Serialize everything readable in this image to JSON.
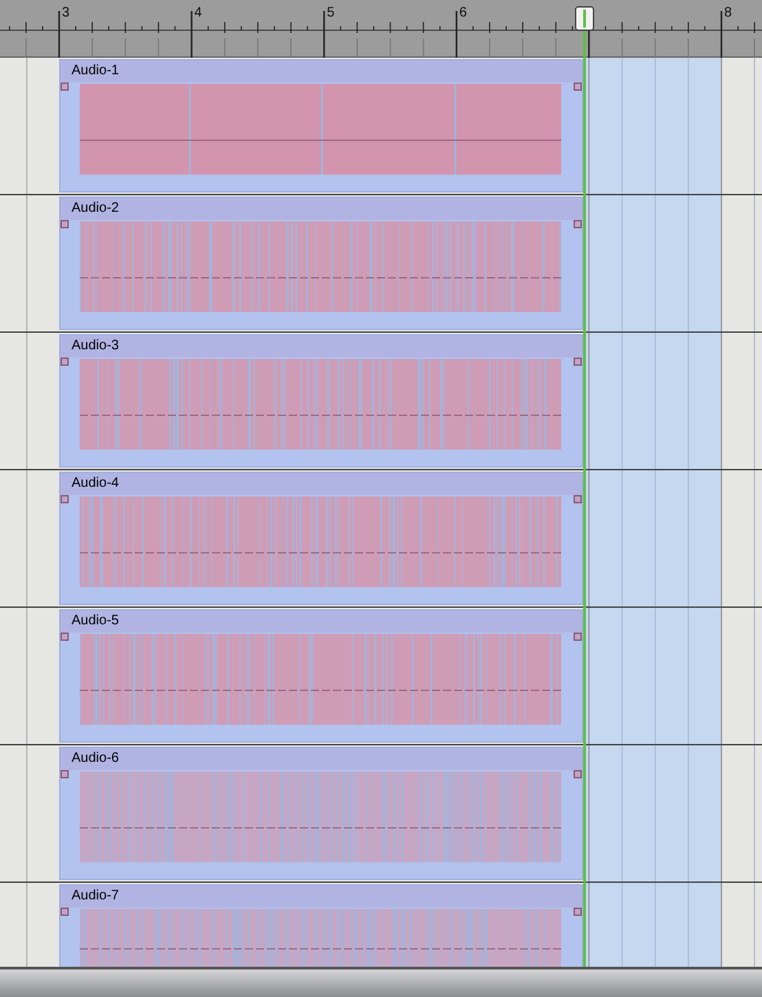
{
  "ruler": {
    "labels": [
      "3",
      "4",
      "5",
      "6",
      "8"
    ]
  },
  "tracks": [
    {
      "name": "Audio-1",
      "kind": "sparse"
    },
    {
      "name": "Audio-2",
      "kind": "medium"
    },
    {
      "name": "Audio-3",
      "kind": "medium"
    },
    {
      "name": "Audio-4",
      "kind": "medium"
    },
    {
      "name": "Audio-5",
      "kind": "medium"
    },
    {
      "name": "Audio-6",
      "kind": "dense"
    },
    {
      "name": "Audio-7",
      "kind": "dense"
    }
  ]
}
